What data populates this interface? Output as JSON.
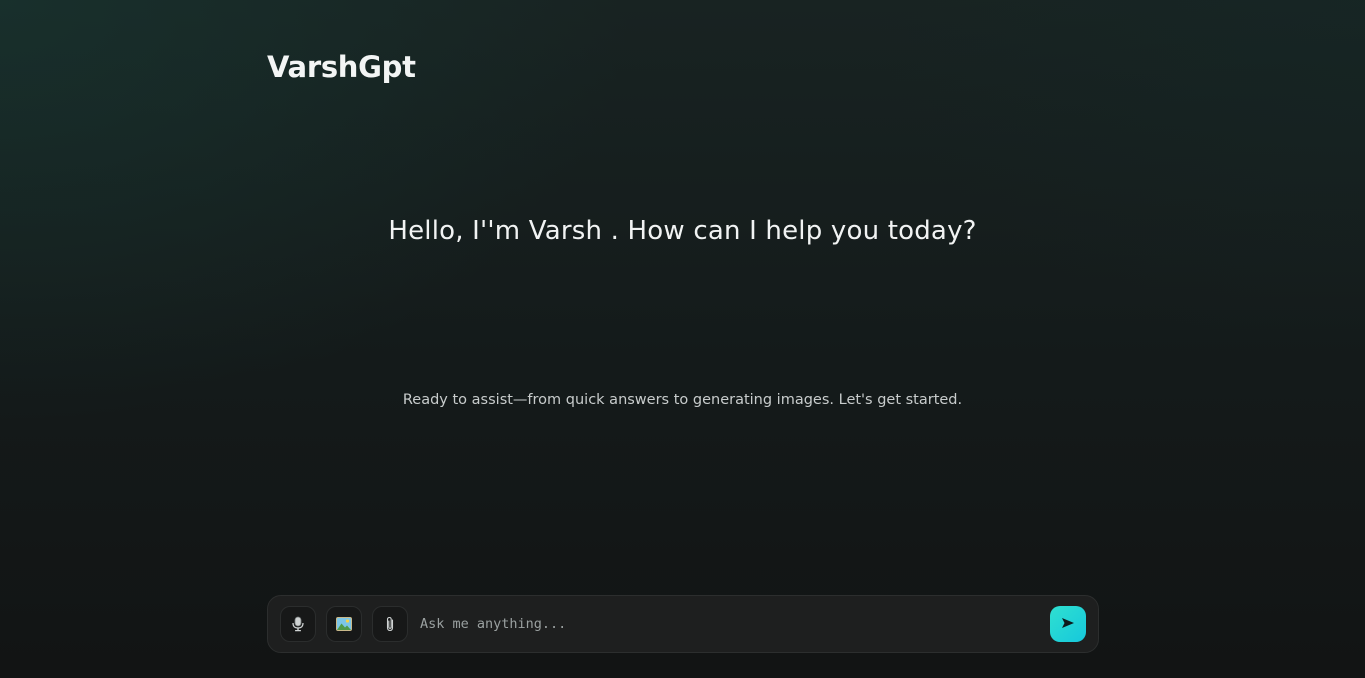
{
  "app": {
    "brand": "VarshGpt"
  },
  "hero": {
    "greeting": "Hello, I''m Varsh . How can I help you today?",
    "subtext": "Ready to assist—from quick answers to generating images. Let's get started."
  },
  "composer": {
    "placeholder": "Ask me anything...",
    "value": "",
    "tools": [
      {
        "icon": "microphone-icon"
      },
      {
        "icon": "image-icon"
      },
      {
        "icon": "paperclip-icon"
      }
    ],
    "send_icon": "send-icon",
    "accent_color": "#22d3d6"
  }
}
